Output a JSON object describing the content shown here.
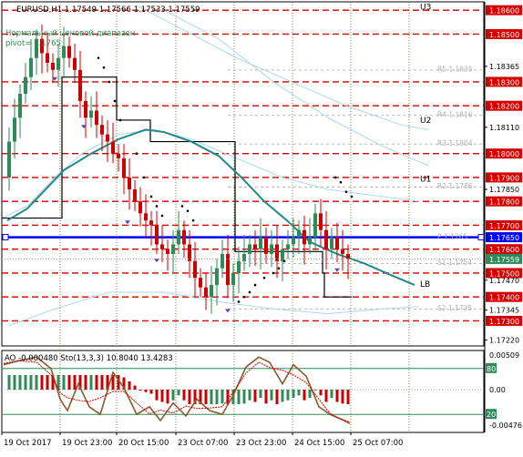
{
  "header": {
    "symbol_line": "EURUSD,H1  1.17549 1.17566 1.17533 1.17559",
    "range_title": "Нормальный ценовой диапазон",
    "pivot_text": "pivot= 1.1765"
  },
  "colors": {
    "background": "#ffffff",
    "bull_candle": "#2e8b57",
    "bear_candle": "#cc0000",
    "level_red": "#d40000",
    "pivot_blue": "#0000ff",
    "ma_teal": "#1f8a88",
    "band_lightblue": "#a8d8e8",
    "step_black": "#000000",
    "grid": "#7f7f3f",
    "sar_dots": "#000000",
    "price_tag_green": "#2e8b57",
    "osc_up": "#2e8b57",
    "osc_down": "#cc0000",
    "stoch_main": "#8b5a2b",
    "stoch_signal": "#cc0000",
    "stoch_level": "#2e8b57"
  },
  "price_axis": {
    "labels": [
      "1.18600",
      "1.18500",
      "1.18365",
      "1.18300",
      "1.18200",
      "1.18110",
      "1.18000",
      "1.17900",
      "1.17850",
      "1.17800",
      "1.17700",
      "1.17650",
      "1.17600",
      "1.17559",
      "1.17500",
      "1.17470",
      "1.17400",
      "1.17345",
      "1.17300",
      "1.17220"
    ],
    "tag_price_levels": [
      "1.18600",
      "1.18500",
      "1.18300",
      "1.18200",
      "1.18000",
      "1.17900",
      "1.17800",
      "1.17700",
      "1.17600",
      "1.17500",
      "1.17400",
      "1.17300"
    ],
    "tag_pivot": "1.17650",
    "tag_current": "1.17559",
    "plain_labels": [
      "1.18365",
      "1.18110",
      "1.17850",
      "1.17470",
      "1.17345",
      "1.17220"
    ]
  },
  "level_labels": [
    {
      "text": "U3",
      "kind": "band"
    },
    {
      "text": "U2",
      "kind": "band"
    },
    {
      "text": "U1",
      "kind": "band"
    },
    {
      "text": "LB",
      "kind": "band"
    },
    {
      "text": "R5 1.1835",
      "kind": "pivot"
    },
    {
      "text": "R4 1.1816",
      "kind": "pivot"
    },
    {
      "text": "R3 1.1804",
      "kind": "pivot"
    },
    {
      "text": "R2 1.1786",
      "kind": "pivot"
    },
    {
      "text": "P 1.1765",
      "kind": "pivot"
    },
    {
      "text": "S1 1.1754",
      "kind": "pivot"
    },
    {
      "text": "S2 1.1735",
      "kind": "pivot"
    }
  ],
  "oscillator": {
    "title": "AO -0.000480  Sto(13,3,3) 10.8040 13.4283",
    "axis_labels": [
      "0.00509",
      "80",
      "0.00",
      "20",
      "-0.00476"
    ],
    "level_high": "80",
    "level_low": "20"
  },
  "time_axis": [
    "19 Oct 2017",
    "19 Oct 23:00",
    "20 Oct 15:00",
    "23 Oct 07:00",
    "23 Oct 23:00",
    "24 Oct 15:00",
    "25 Oct 07:00"
  ]
}
